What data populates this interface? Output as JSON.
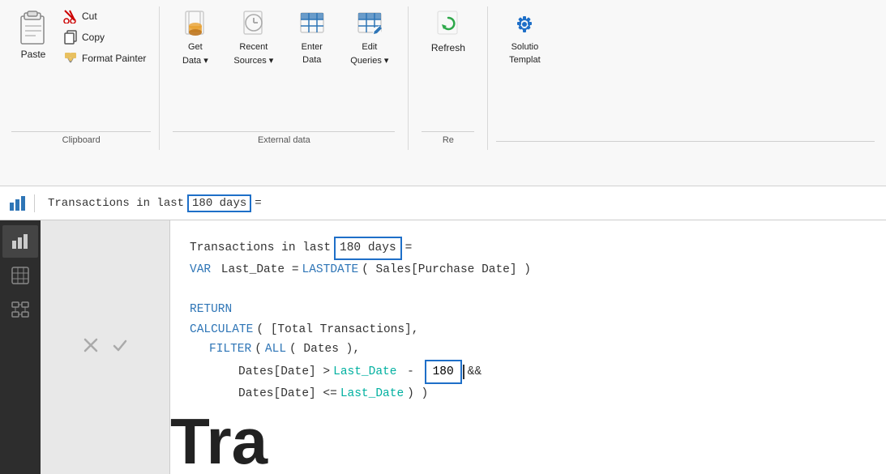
{
  "ribbon": {
    "groups": [
      {
        "name": "Clipboard",
        "label": "Clipboard",
        "items": [
          {
            "id": "paste",
            "label": "Paste",
            "size": "large"
          },
          {
            "id": "cut",
            "label": "Cut",
            "size": "small"
          },
          {
            "id": "copy",
            "label": "Copy",
            "size": "small"
          },
          {
            "id": "format-painter",
            "label": "Format Painter",
            "size": "small"
          }
        ]
      },
      {
        "name": "ExternalData",
        "label": "External data",
        "items": [
          {
            "id": "get-data",
            "label": "Get Data",
            "hasDropdown": true
          },
          {
            "id": "recent-sources",
            "label": "Recent Sources",
            "hasDropdown": true
          },
          {
            "id": "enter-data",
            "label": "Enter Data",
            "hasDropdown": false
          },
          {
            "id": "edit-queries",
            "label": "Edit Queries",
            "hasDropdown": true
          }
        ]
      },
      {
        "name": "Refresh",
        "label": "Re",
        "items": [
          {
            "id": "refresh",
            "label": "Refresh",
            "size": "large"
          }
        ]
      },
      {
        "name": "Solutions",
        "label": "",
        "items": [
          {
            "id": "solution-templates",
            "label": "Solution Templates",
            "size": "large"
          }
        ]
      }
    ]
  },
  "formula_bar": {
    "measure_name": "Transactions in last",
    "highlight_value": "180 days",
    "equals_sign": "="
  },
  "sidebar": {
    "items": [
      {
        "id": "report",
        "icon": "bar-chart",
        "active": true
      },
      {
        "id": "data",
        "icon": "table-grid"
      },
      {
        "id": "model",
        "icon": "relationship"
      }
    ]
  },
  "formula_buttons": {
    "cancel": "×",
    "confirm": "✓"
  },
  "dax_code": {
    "line1_prefix": "Transactions in last",
    "line1_highlight": "180 days",
    "line1_suffix": "=",
    "line2": "VAR Last_Date = LASTDATE( Sales[Purchase Date] )",
    "line3": "",
    "line4": "RETURN",
    "line5": "CALCULATE( [Total Transactions],",
    "line6": "    FILTER( ALL( Dates ),",
    "line7_prefix": "        Dates[Date] > ",
    "line7_teal": "Last_Date",
    "line7_middle": " - ",
    "line7_highlight": "180",
    "line7_suffix": "&&",
    "line8_prefix": "        Dates[Date] <= ",
    "line8_teal": "Last_Date",
    "line8_suffix": " ) )",
    "large_text": "Tra"
  },
  "colors": {
    "accent_blue": "#2e75b6",
    "highlight_border": "#1e6fc8",
    "teal": "#00b0a0",
    "sidebar_bg": "#2d2d2d",
    "ribbon_bg": "#f8f8f8"
  }
}
